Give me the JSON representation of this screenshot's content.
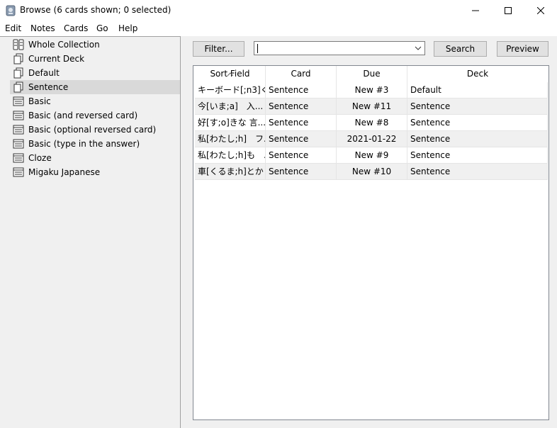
{
  "window": {
    "title": "Browse (6 cards shown; 0 selected)"
  },
  "menu": [
    "Edit",
    "Notes",
    "Cards",
    "Go",
    "Help"
  ],
  "sidebar": {
    "items": [
      {
        "label": "Whole Collection",
        "icon": "collection-icon"
      },
      {
        "label": "Current Deck",
        "icon": "deck-icon"
      },
      {
        "label": "Default",
        "icon": "deck-icon"
      },
      {
        "label": "Sentence",
        "icon": "deck-icon",
        "selected": true
      },
      {
        "label": "Basic",
        "icon": "notetype-icon"
      },
      {
        "label": "Basic (and reversed card)",
        "icon": "notetype-icon"
      },
      {
        "label": "Basic (optional reversed card)",
        "icon": "notetype-icon"
      },
      {
        "label": "Basic (type in the answer)",
        "icon": "notetype-icon"
      },
      {
        "label": "Cloze",
        "icon": "notetype-icon"
      },
      {
        "label": "Migaku Japanese",
        "icon": "notetype-icon"
      }
    ]
  },
  "toolbar": {
    "filter_label": "Filter...",
    "search_value": "",
    "search_label": "Search",
    "preview_label": "Preview"
  },
  "table": {
    "columns": [
      "Sort Field",
      "Card",
      "Due",
      "Deck"
    ],
    "rows": [
      [
        "キーボード[;n3]く...",
        "Sentence",
        "New #3",
        "Default"
      ],
      [
        "今[いま;a]　入...",
        "Sentence",
        "New #11",
        "Sentence"
      ],
      [
        "好[す;o]きな 言...",
        "Sentence",
        "New #8",
        "Sentence"
      ],
      [
        "私[わたし;h]　フ...",
        "Sentence",
        "2021-01-22",
        "Sentence"
      ],
      [
        "私[わたし;h]も　...",
        "Sentence",
        "New #9",
        "Sentence"
      ],
      [
        "車[くるま;h]とか ...",
        "Sentence",
        "New #10",
        "Sentence"
      ]
    ]
  }
}
